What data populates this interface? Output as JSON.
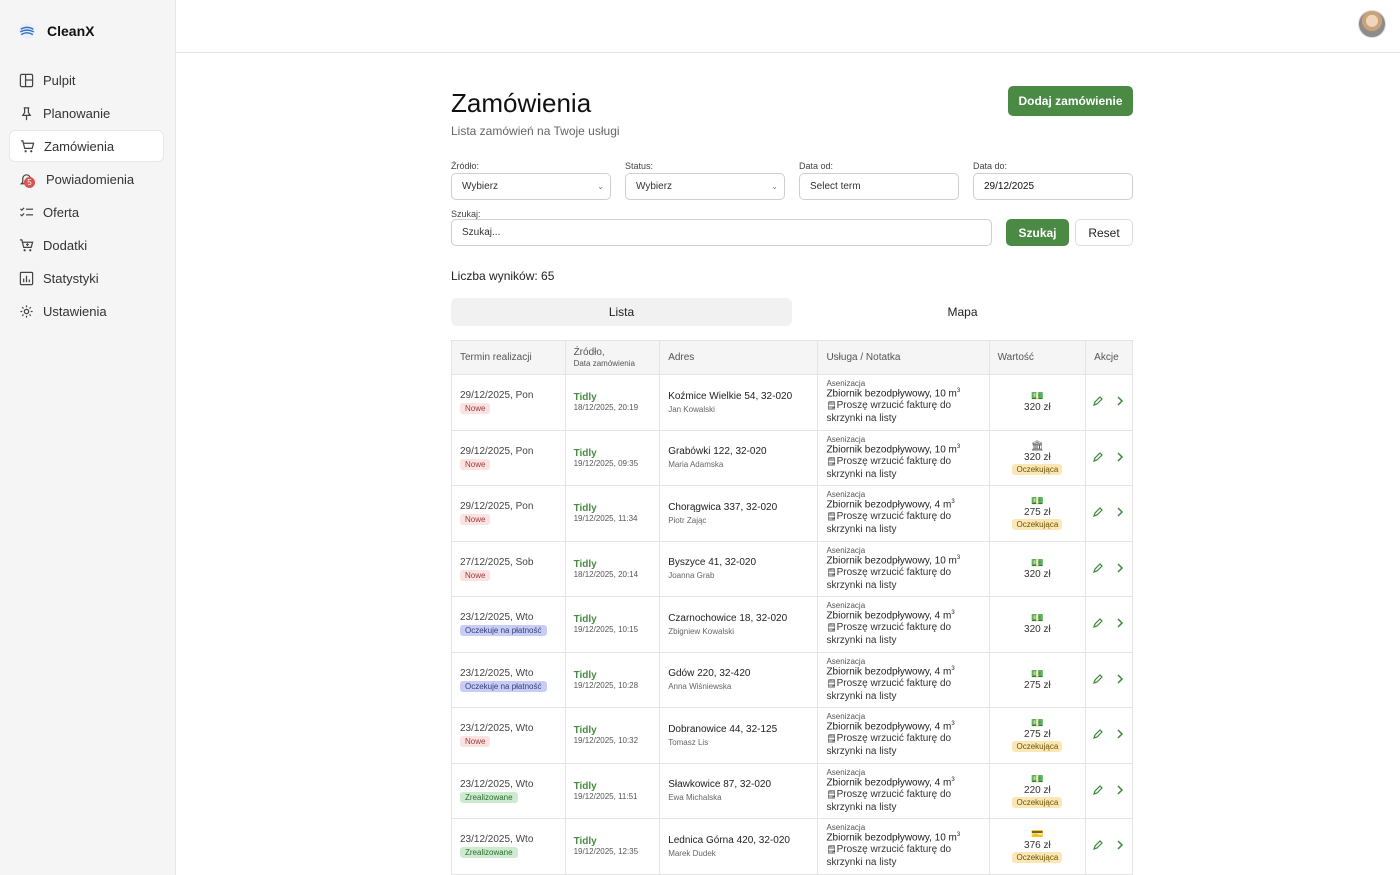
{
  "app": {
    "name": "CleanX"
  },
  "sidebar": {
    "items": [
      {
        "label": "Pulpit",
        "icon": "dashboard-icon",
        "active": false
      },
      {
        "label": "Planowanie",
        "icon": "pin-icon",
        "active": false
      },
      {
        "label": "Zamówienia",
        "icon": "cart-icon",
        "active": true
      },
      {
        "label": "Powiadomienia",
        "icon": "bell-icon",
        "active": false,
        "badge": "5"
      },
      {
        "label": "Oferta",
        "icon": "checklist-icon",
        "active": false
      },
      {
        "label": "Dodatki",
        "icon": "cart-plus-icon",
        "active": false
      },
      {
        "label": "Statystyki",
        "icon": "chart-icon",
        "active": false
      },
      {
        "label": "Ustawienia",
        "icon": "gear-icon",
        "active": false
      }
    ]
  },
  "header": {
    "avatar": "user-avatar"
  },
  "page": {
    "title": "Zamówienia",
    "subtitle": "Lista zamówień na Twoje usługi",
    "add_button": "Dodaj zamówienie"
  },
  "filters": {
    "source_label": "Źródło:",
    "source_value": "Wybierz",
    "status_label": "Status:",
    "status_value": "Wybierz",
    "date_from_label": "Data od:",
    "date_from_value": "Select term",
    "date_to_label": "Data do:",
    "date_to_value": "29/12/2025",
    "search_label": "Szukaj:",
    "search_placeholder": "Szukaj...",
    "search_button": "Szukaj",
    "reset_button": "Reset"
  },
  "results": {
    "count_text": "Liczba wyników: 65"
  },
  "tabs": {
    "list": "Lista",
    "map": "Mapa"
  },
  "table": {
    "headers": {
      "term": "Termin realizacji",
      "source": "Źródło,",
      "source_sub": "Data zamówienia",
      "address": "Adres",
      "service": "Usługa / Notatka",
      "value": "Wartość",
      "actions": "Akcje"
    },
    "rows": [
      {
        "term": "29/12/2025, Pon",
        "status": "Nowe",
        "status_color": "#fde2e2",
        "status_text_color": "#9a3b3b",
        "source": "Tidly",
        "order_date": "18/12/2025, 20:19",
        "address": "Koźmice Wielkie 54, 32-020",
        "person": "Jan Kowalski",
        "service_cat": "Asenizacja",
        "service": "Zbiornik bezodpływowy, 10 m",
        "unit_sup": "3",
        "note": "Proszę wrzucić fakturę do skrzynki na listy",
        "pay_icon": "cash-icon",
        "value": "320 zł",
        "pending": ""
      },
      {
        "term": "29/12/2025, Pon",
        "status": "Nowe",
        "status_color": "#fde2e2",
        "status_text_color": "#9a3b3b",
        "source": "Tidly",
        "order_date": "19/12/2025, 09:35",
        "address": "Grabówki 122, 32-020",
        "person": "Maria Adamska",
        "service_cat": "Asenizacja",
        "service": "Zbiornik bezodpływowy, 10 m",
        "unit_sup": "3",
        "note": "Proszę wrzucić fakturę do skrzynki na listy",
        "pay_icon": "bank-icon",
        "value": "320 zł",
        "pending": "Oczekująca"
      },
      {
        "term": "29/12/2025, Pon",
        "status": "Nowe",
        "status_color": "#fde2e2",
        "status_text_color": "#9a3b3b",
        "source": "Tidly",
        "order_date": "19/12/2025, 11:34",
        "address": "Chorągwica 337, 32-020",
        "person": "Piotr Zając",
        "service_cat": "Asenizacja",
        "service": "Zbiornik bezodpływowy, 4 m",
        "unit_sup": "3",
        "note": "Proszę wrzucić fakturę do skrzynki na listy",
        "pay_icon": "cash-icon",
        "value": "275 zł",
        "pending": "Oczekująca"
      },
      {
        "term": "27/12/2025, Sob",
        "status": "Nowe",
        "status_color": "#fde2e2",
        "status_text_color": "#9a3b3b",
        "source": "Tidly",
        "order_date": "18/12/2025, 20:14",
        "address": "Byszyce 41, 32-020",
        "person": "Joanna Grab",
        "service_cat": "Asenizacja",
        "service": "Zbiornik bezodpływowy, 10 m",
        "unit_sup": "3",
        "note": "Proszę wrzucić fakturę do skrzynki na listy",
        "pay_icon": "cash-icon",
        "value": "320 zł",
        "pending": ""
      },
      {
        "term": "23/12/2025, Wto",
        "status": "Oczekuje na płatność",
        "status_color": "#c8cdf5",
        "status_text_color": "#34407a",
        "source": "Tidly",
        "order_date": "19/12/2025, 10:15",
        "address": "Czarnochowice 18, 32-020",
        "person": "Zbigniew Kowalski",
        "service_cat": "Asenizacja",
        "service": "Zbiornik bezodpływowy, 4 m",
        "unit_sup": "3",
        "note": "Proszę wrzucić fakturę do skrzynki na listy",
        "pay_icon": "cash-icon",
        "value": "320 zł",
        "pending": ""
      },
      {
        "term": "23/12/2025, Wto",
        "status": "Oczekuje na płatność",
        "status_color": "#c8cdf5",
        "status_text_color": "#34407a",
        "source": "Tidly",
        "order_date": "19/12/2025, 10:28",
        "address": "Gdów 220, 32-420",
        "person": "Anna Wiśniewska",
        "service_cat": "Asenizacja",
        "service": "Zbiornik bezodpływowy, 4 m",
        "unit_sup": "3",
        "note": "Proszę wrzucić fakturę do skrzynki na listy",
        "pay_icon": "cash-icon",
        "value": "275 zł",
        "pending": ""
      },
      {
        "term": "23/12/2025, Wto",
        "status": "Nowe",
        "status_color": "#fde2e2",
        "status_text_color": "#9a3b3b",
        "source": "Tidly",
        "order_date": "19/12/2025, 10:32",
        "address": "Dobranowice 44, 32-125",
        "person": "Tomasz Lis",
        "service_cat": "Asenizacja",
        "service": "Zbiornik bezodpływowy, 4 m",
        "unit_sup": "3",
        "note": "Proszę wrzucić fakturę do skrzynki na listy",
        "pay_icon": "cash-icon",
        "value": "275 zł",
        "pending": "Oczekująca"
      },
      {
        "term": "23/12/2025, Wto",
        "status": "Zrealizowane",
        "status_color": "#cdeccf",
        "status_text_color": "#2f6a31",
        "source": "Tidly",
        "order_date": "19/12/2025, 11:51",
        "address": "Sławkowice 87, 32-020",
        "person": "Ewa Michalska",
        "service_cat": "Asenizacja",
        "service": "Zbiornik bezodpływowy, 4 m",
        "unit_sup": "3",
        "note": "Proszę wrzucić fakturę do skrzynki na listy",
        "pay_icon": "cash-icon",
        "value": "220 zł",
        "pending": "Oczekująca"
      },
      {
        "term": "23/12/2025, Wto",
        "status": "Zrealizowane",
        "status_color": "#cdeccf",
        "status_text_color": "#2f6a31",
        "source": "Tidly",
        "order_date": "19/12/2025, 12:35",
        "address": "Lednica Górna 420, 32-020",
        "person": "Marek Dudek",
        "service_cat": "Asenizacja",
        "service": "Zbiornik bezodpływowy, 10 m",
        "unit_sup": "3",
        "note": "Proszę wrzucić fakturę do skrzynki na listy",
        "pay_icon": "card-icon",
        "value": "376 zł",
        "pending": "Oczekująca"
      }
    ]
  },
  "colors": {
    "accent": "#4a8a45",
    "pending_bg": "#fbe7b5"
  }
}
